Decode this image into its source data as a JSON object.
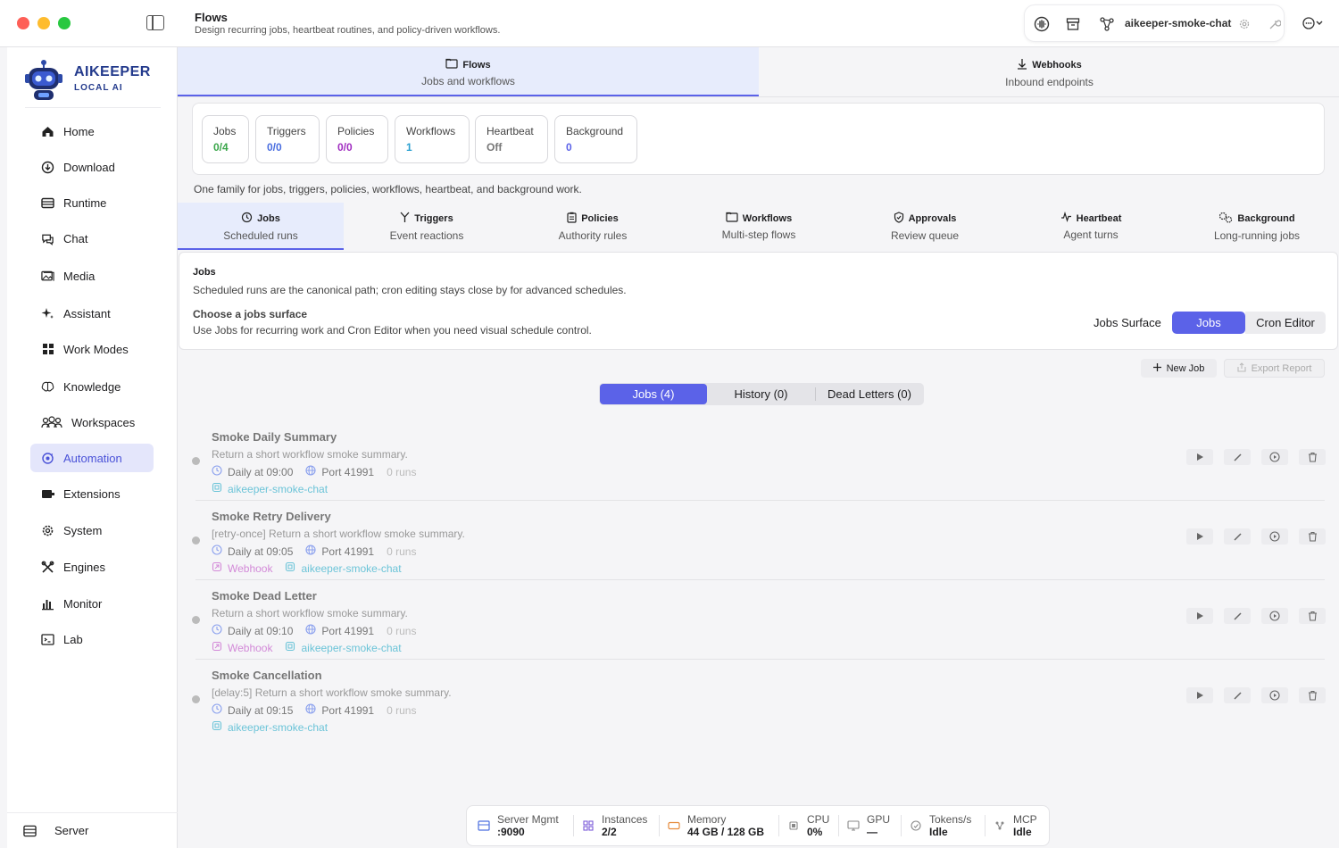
{
  "header": {
    "title": "Flows",
    "subtitle": "Design recurring jobs, heartbeat routines, and policy-driven workflows.",
    "instance_name": "aikeeper-smoke-chat"
  },
  "logo": {
    "name": "AIKEEPER",
    "tagline": "LOCAL AI"
  },
  "sidebar": {
    "items": [
      {
        "label": "Home",
        "icon": "home-icon"
      },
      {
        "label": "Download",
        "icon": "download-icon"
      },
      {
        "label": "Runtime",
        "icon": "runtime-icon"
      },
      {
        "label": "Chat",
        "icon": "chat-icon"
      },
      {
        "label": "Media",
        "icon": "media-icon"
      },
      {
        "label": "Assistant",
        "icon": "sparkle-icon"
      },
      {
        "label": "Work Modes",
        "icon": "grid-icon"
      },
      {
        "label": "Knowledge",
        "icon": "brain-icon"
      },
      {
        "label": "Workspaces",
        "icon": "users-icon"
      },
      {
        "label": "Automation",
        "icon": "automation-icon",
        "active": true
      },
      {
        "label": "Extensions",
        "icon": "plugin-icon"
      },
      {
        "label": "System",
        "icon": "gear-icon"
      },
      {
        "label": "Engines",
        "icon": "tools-icon"
      },
      {
        "label": "Monitor",
        "icon": "chart-icon"
      },
      {
        "label": "Lab",
        "icon": "terminal-icon"
      }
    ],
    "server_label": "Server"
  },
  "top_tabs": [
    {
      "title": "Flows",
      "subtitle": "Jobs and workflows",
      "active": true,
      "icon": "folder-icon"
    },
    {
      "title": "Webhooks",
      "subtitle": "Inbound endpoints",
      "active": false,
      "icon": "download-icon"
    }
  ],
  "stats": [
    {
      "label": "Jobs",
      "value": "0/4",
      "color": "#3aa64a"
    },
    {
      "label": "Triggers",
      "value": "0/0",
      "color": "#4a6ee0"
    },
    {
      "label": "Policies",
      "value": "0/0",
      "color": "#a02ec0"
    },
    {
      "label": "Workflows",
      "value": "1",
      "color": "#2aa0d0"
    },
    {
      "label": "Heartbeat",
      "value": "Off",
      "color": "#777777"
    },
    {
      "label": "Background",
      "value": "0",
      "color": "#5b62e8"
    }
  ],
  "family_note": "One family for jobs, triggers, policies, workflows, heartbeat, and background work.",
  "sub_tabs": [
    {
      "title": "Jobs",
      "subtitle": "Scheduled runs",
      "active": true,
      "icon": "history-icon"
    },
    {
      "title": "Triggers",
      "subtitle": "Event reactions",
      "active": false,
      "icon": "trigger-icon"
    },
    {
      "title": "Policies",
      "subtitle": "Authority rules",
      "active": false,
      "icon": "clipboard-icon"
    },
    {
      "title": "Workflows",
      "subtitle": "Multi-step flows",
      "active": false,
      "icon": "folder-icon"
    },
    {
      "title": "Approvals",
      "subtitle": "Review queue",
      "active": false,
      "icon": "shield-check-icon"
    },
    {
      "title": "Heartbeat",
      "subtitle": "Agent turns",
      "active": false,
      "icon": "pulse-icon"
    },
    {
      "title": "Background",
      "subtitle": "Long-running jobs",
      "active": false,
      "icon": "gears-icon"
    }
  ],
  "jobs_info": {
    "title": "Jobs",
    "description": "Scheduled runs are the canonical path; cron editing stays close by for advanced schedules.",
    "choose_title": "Choose a jobs surface",
    "choose_desc": "Use Jobs for recurring work and Cron Editor when you need visual schedule control.",
    "surface_label": "Jobs Surface",
    "surface_options": [
      "Jobs",
      "Cron Editor"
    ],
    "surface_selected": "Jobs"
  },
  "actions": {
    "new_job": "New Job",
    "export_report": "Export Report"
  },
  "list_tabs": [
    "Jobs (4)",
    "History (0)",
    "Dead Letters (0)"
  ],
  "jobs": [
    {
      "title": "Smoke Daily Summary",
      "desc": "Return a short workflow smoke summary.",
      "schedule": "Daily at 09:00",
      "port": "Port 41991",
      "runs": "0 runs",
      "webhook": "",
      "agent": "aikeeper-smoke-chat"
    },
    {
      "title": "Smoke Retry Delivery",
      "desc": "[retry-once] Return a short workflow smoke summary.",
      "schedule": "Daily at 09:05",
      "port": "Port 41991",
      "runs": "0 runs",
      "webhook": "Webhook",
      "agent": "aikeeper-smoke-chat"
    },
    {
      "title": "Smoke Dead Letter",
      "desc": "Return a short workflow smoke summary.",
      "schedule": "Daily at 09:10",
      "port": "Port 41991",
      "runs": "0 runs",
      "webhook": "Webhook",
      "agent": "aikeeper-smoke-chat"
    },
    {
      "title": "Smoke Cancellation",
      "desc": "[delay:5] Return a short workflow smoke summary.",
      "schedule": "Daily at 09:15",
      "port": "Port 41991",
      "runs": "0 runs",
      "webhook": "",
      "agent": "aikeeper-smoke-chat"
    }
  ],
  "status_bar": [
    {
      "label": "Server Mgmt",
      "value": ":9090",
      "icon": "server-icon"
    },
    {
      "label": "Instances",
      "value": "2/2",
      "icon": "grid-icon"
    },
    {
      "label": "Memory",
      "value": "44 GB / 128 GB",
      "icon": "memory-icon"
    },
    {
      "label": "CPU",
      "value": "0%",
      "icon": "cpu-icon"
    },
    {
      "label": "GPU",
      "value": "—",
      "icon": "gpu-icon"
    },
    {
      "label": "Tokens/s",
      "value": "Idle",
      "icon": "gauge-icon"
    },
    {
      "label": "MCP",
      "value": "Idle",
      "icon": "mcp-icon"
    }
  ]
}
